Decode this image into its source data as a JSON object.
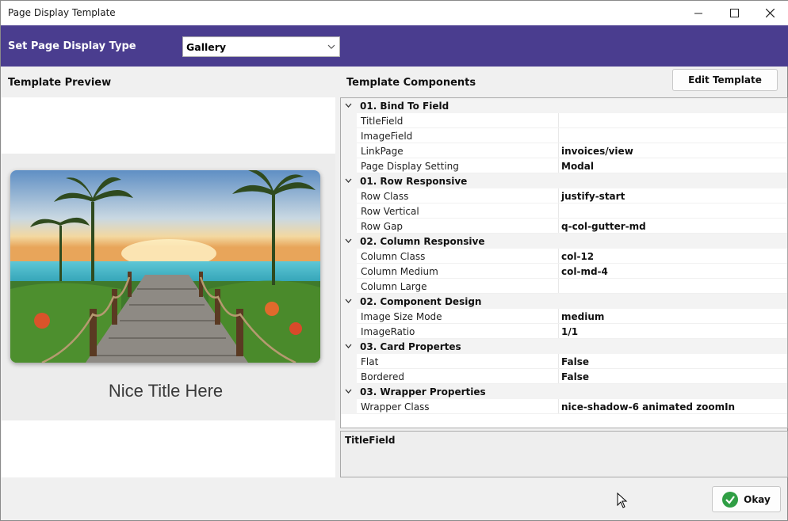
{
  "window": {
    "title": "Page Display Template"
  },
  "header": {
    "label": "Set Page Display Type",
    "display_type": "Gallery"
  },
  "preview": {
    "title": "Template Preview",
    "card_title": "Nice Title Here"
  },
  "components": {
    "title": "Template Components",
    "edit_button": "Edit Template",
    "groups": [
      {
        "name": "01. Bind To Field",
        "props": [
          {
            "name": "TitleField",
            "value": ""
          },
          {
            "name": "ImageField",
            "value": ""
          },
          {
            "name": "LinkPage",
            "value": "invoices/view"
          },
          {
            "name": "Page Display Setting",
            "value": "Modal"
          }
        ]
      },
      {
        "name": "01. Row Responsive",
        "props": [
          {
            "name": "Row Class",
            "value": "justify-start"
          },
          {
            "name": "Row Vertical",
            "value": ""
          },
          {
            "name": "Row Gap",
            "value": "q-col-gutter-md"
          }
        ]
      },
      {
        "name": "02. Column Responsive",
        "props": [
          {
            "name": "Column Class",
            "value": "col-12"
          },
          {
            "name": "Column Medium",
            "value": "col-md-4"
          },
          {
            "name": "Column Large",
            "value": ""
          }
        ]
      },
      {
        "name": "02. Component Design",
        "props": [
          {
            "name": "Image Size Mode",
            "value": "medium"
          },
          {
            "name": "ImageRatio",
            "value": "1/1"
          }
        ]
      },
      {
        "name": "03. Card Propertes",
        "props": [
          {
            "name": "Flat",
            "value": "False"
          },
          {
            "name": "Bordered",
            "value": "False"
          }
        ]
      },
      {
        "name": "03. Wrapper Properties",
        "props": [
          {
            "name": "Wrapper Class",
            "value": "nice-shadow-6 animated zoomIn"
          }
        ]
      }
    ],
    "description_title": "TitleField"
  },
  "footer": {
    "okay_button": "Okay"
  },
  "colors": {
    "header_band": "#4a3d8f",
    "okay_check": "#2f9e44"
  }
}
